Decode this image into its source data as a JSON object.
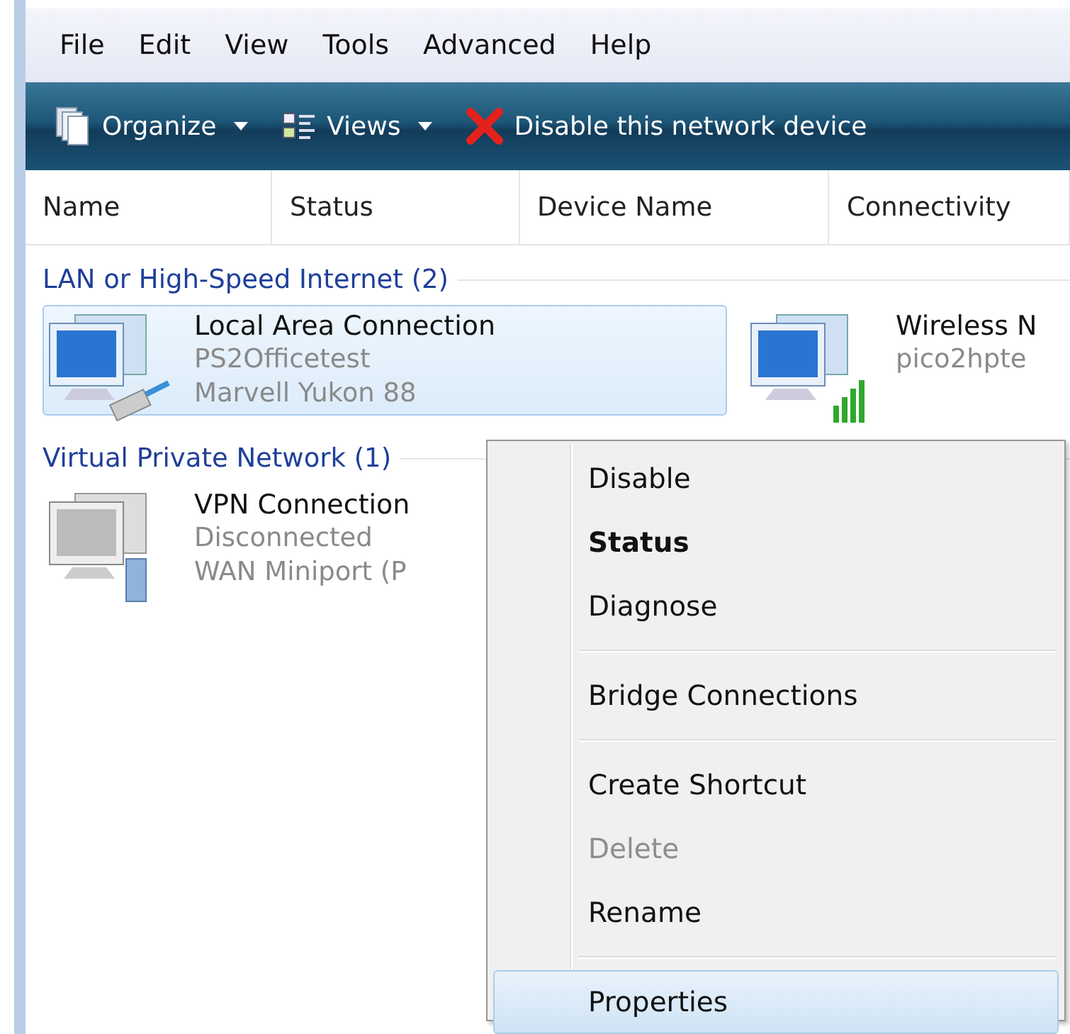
{
  "menu_bar": [
    "File",
    "Edit",
    "View",
    "Tools",
    "Advanced",
    "Help"
  ],
  "toolbar": [
    {
      "kind": "organize",
      "label": "Organize",
      "dropdown": true
    },
    {
      "kind": "views",
      "label": "Views",
      "dropdown": true
    },
    {
      "kind": "disable",
      "label": "Disable this network device",
      "dropdown": false
    }
  ],
  "columns": [
    "Name",
    "Status",
    "Device Name",
    "Connectivity"
  ],
  "groups": [
    {
      "title": "LAN or High-Speed Internet (2)",
      "items": [
        {
          "kind": "wired",
          "name": "Local Area Connection",
          "lines": [
            "PS2Officetest",
            "Marvell Yukon 88"
          ],
          "selected": true
        },
        {
          "kind": "wireless",
          "name": "Wireless N",
          "lines": [
            "pico2hpte"
          ],
          "selected": false
        }
      ]
    },
    {
      "title": "Virtual Private Network (1)",
      "items": [
        {
          "kind": "vpn",
          "name": "VPN Connection",
          "lines": [
            "Disconnected",
            "WAN Miniport (P"
          ],
          "selected": false
        }
      ]
    }
  ],
  "context_menu": {
    "sections": [
      [
        {
          "label": "Disable",
          "default": false,
          "disabled": false,
          "selected": false
        },
        {
          "label": "Status",
          "default": true,
          "disabled": false,
          "selected": false
        },
        {
          "label": "Diagnose",
          "default": false,
          "disabled": false,
          "selected": false
        }
      ],
      [
        {
          "label": "Bridge Connections",
          "default": false,
          "disabled": false,
          "selected": false
        }
      ],
      [
        {
          "label": "Create Shortcut",
          "default": false,
          "disabled": false,
          "selected": false
        },
        {
          "label": "Delete",
          "default": false,
          "disabled": true,
          "selected": false
        },
        {
          "label": "Rename",
          "default": false,
          "disabled": false,
          "selected": false
        }
      ],
      [
        {
          "label": "Properties",
          "default": false,
          "disabled": false,
          "selected": true
        }
      ]
    ]
  }
}
